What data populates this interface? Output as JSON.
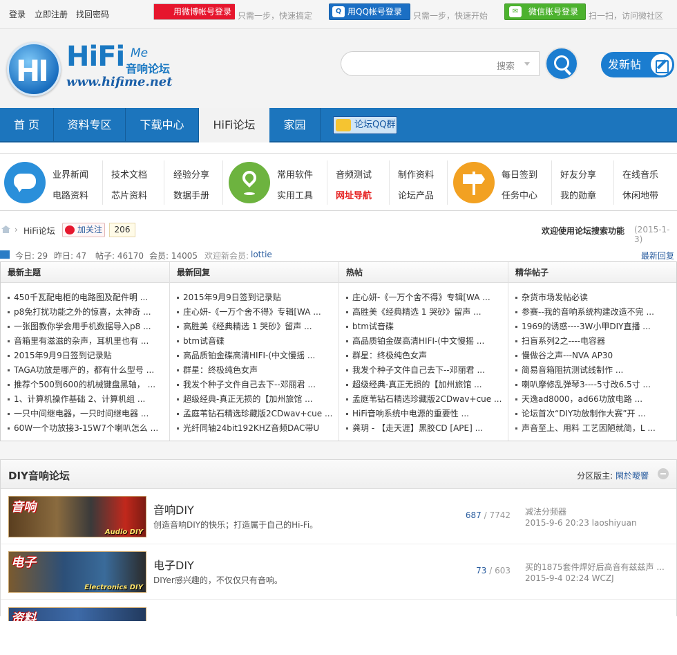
{
  "topbar": {
    "login": "登录",
    "register": "立即注册",
    "recover": "找回密码",
    "weibo_btn": "用微博帐号登录",
    "weibo_hint": "只需一步，快速搞定",
    "qq_btn": "用QQ帐号登录",
    "qq_hint": "只需一步，快速开始",
    "wechat_btn": "微信账号登录",
    "wechat_hint": "扫一扫，访问微社区"
  },
  "logo": {
    "badge": "HI",
    "brand": "HiFi",
    "me": "Me",
    "cn": "音响论坛",
    "url": "www.hifime.net"
  },
  "search": {
    "placeholder": "搜索"
  },
  "post_button": "发新帖",
  "nav": {
    "items": [
      "首 页",
      "资料专区",
      "下载中心",
      "HiFi论坛",
      "家园"
    ],
    "qq_group": "论坛QQ群"
  },
  "quick": {
    "group1": [
      "业界新闻",
      "技术文档",
      "经验分享",
      "电路资料",
      "芯片资料",
      "数据手册"
    ],
    "group2": [
      "常用软件",
      "音频测试",
      "制作资料",
      "实用工具",
      "网址导航",
      "论坛产品"
    ],
    "group3": [
      "每日签到",
      "好友分享",
      "在线音乐",
      "任务中心",
      "我的勋章",
      "休闲地带"
    ]
  },
  "crumb": {
    "forum": "HiFi论坛",
    "follow": "加关注",
    "count": "206",
    "notice": "欢迎使用论坛搜索功能",
    "date": "(2015-1-3)"
  },
  "stats": {
    "today": "今日: 29",
    "yesterday": "昨日: 47",
    "posts": "帖子: 46170",
    "members": "会员: 14005",
    "newmember_label": "欢迎新会员: ",
    "newmember": "lottie",
    "latest": "最新回复"
  },
  "columns": [
    {
      "title": "最新主题",
      "items": [
        "450千瓦配电柜的电路图及配件明 ...",
        "p8免打扰功能之外的惊喜，太神奇 ...",
        "一张图教你学会用手机数据导入p8 ...",
        "音箱里有滋滋的杂声，耳机里也有 ...",
        "2015年9月9日签到记录贴",
        "TAGA功放是哪产的，都有什么型号 ...",
        "推荐个500到600的机械键盘黑轴， ...",
        "1、计算机操作基础 2、计算机组 ...",
        "一只中间继电器，一只时间继电器 ...",
        "60W一个功放接3-15W7个喇叭怎么 ..."
      ]
    },
    {
      "title": "最新回复",
      "items": [
        "2015年9月9日签到记录贴",
        "庄心妍-《一万个舍不得》专辑[WA ...",
        "高胜美《经典精选 1 哭砂》留声 ...",
        "btm试音碟",
        "高品质铂金碟高清HIFI-(中文慢摇 ...",
        "群星：终极纯色女声",
        "我发个种子文件自己去下--邓丽君 ...",
        "超级经典-真正无损的【加州旅馆 ...",
        "孟庭苇钻石精选珍藏版2CDwav+cue ...",
        "光纤同轴24bit192KHZ音频DAC带U"
      ]
    },
    {
      "title": "热帖",
      "items": [
        "庄心妍-《一万个舍不得》专辑[WA ...",
        "高胜美《经典精选 1 哭砂》留声 ...",
        "btm试音碟",
        "高品质铂金碟高清HIFI-(中文慢摇 ...",
        "群星：终极纯色女声",
        "我发个种子文件自己去下--邓丽君 ...",
        "超级经典-真正无损的【加州旅馆 ...",
        "孟庭苇钻石精选珍藏版2CDwav+cue ...",
        "HiFi音响系统中电源的重要性 ...",
        "龚玥 - 【走天涯】黑胶CD [APE] ..."
      ]
    },
    {
      "title": "精华帖子",
      "items": [
        "杂货市场发帖必读",
        "参赛--我的音响系统构建改造不完 ...",
        "1969的诱惑----3W小甲DIY直播 ...",
        "扫盲系列2之----电容器",
        "慢做谷之声---NVA AP30",
        "简易音箱阻抗测试线制作 ...",
        "喇叭摩修乱弹琴3----5寸改6.5寸 ...",
        "天逸ad8000，ad66功放电路 ...",
        "论坛首次“DIY功放制作大赛”开 ...",
        "声音至上、用料 工艺因陋就简，L ..."
      ]
    }
  ],
  "diy": {
    "title": "DIY音响论坛",
    "mod_label": "分区版主: ",
    "mod_name": "閑於曖響",
    "forums": [
      {
        "thumb_cn": "音响",
        "thumb_en": "Audio DIY",
        "name": "音响DIY",
        "desc": "创造音响DIY的快乐；打造属于自己的Hi-Fi。",
        "threads": "687",
        "posts": "7742",
        "last_title": "减法分频器",
        "last_meta": "2015-9-6 20:23 laoshiyuan"
      },
      {
        "thumb_cn": "电子",
        "thumb_en": "Electronics DIY",
        "name": "电子DIY",
        "desc": "DIYer感兴趣的，不仅仅只有音响。",
        "threads": "73",
        "posts": "603",
        "last_title": "买的1875套件焊好后高音有兹兹声 ...",
        "last_meta": "2015-9-4 02:24 WCZJ"
      },
      {
        "thumb_cn": "资料",
        "thumb_en": "",
        "name": "",
        "desc": "",
        "threads": "",
        "posts": "",
        "last_title": "",
        "last_meta": ""
      }
    ]
  }
}
